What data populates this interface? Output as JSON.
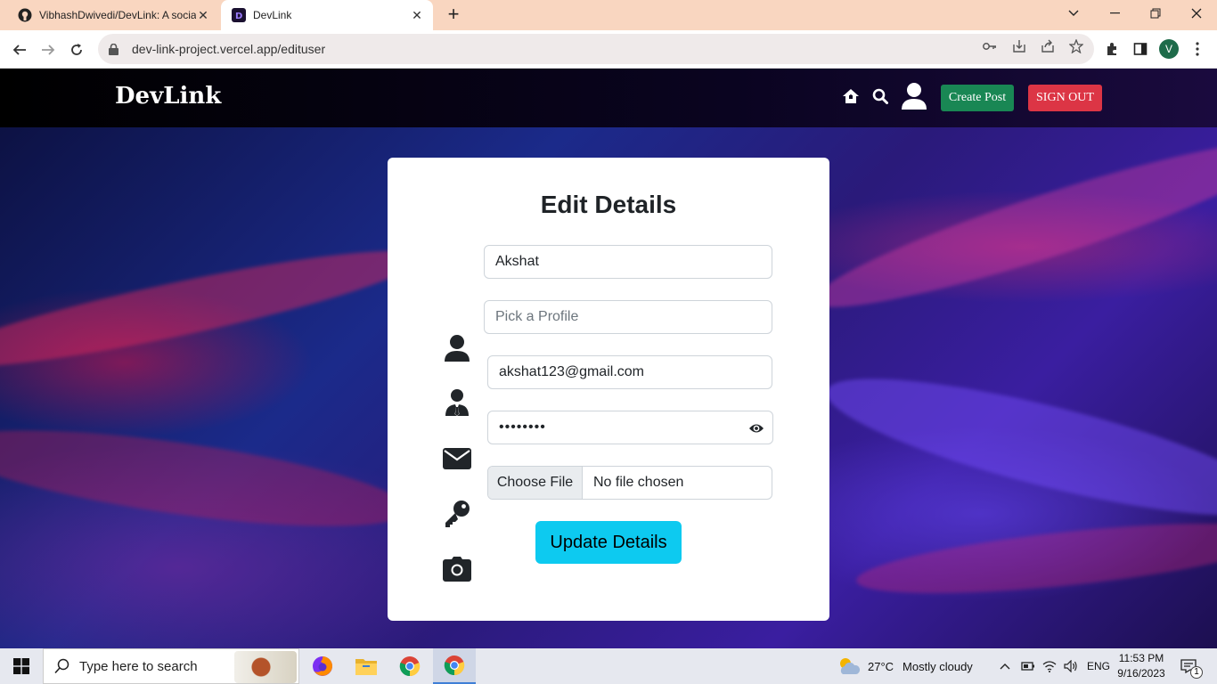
{
  "browser": {
    "tabs": [
      {
        "title": "VibhashDwivedi/DevLink: A socia",
        "favicon": "github-icon",
        "active": false
      },
      {
        "title": "DevLink",
        "favicon": "devlink-icon",
        "active": true
      }
    ],
    "url": "dev-link-project.vercel.app/edituser",
    "profile_initial": "V"
  },
  "app": {
    "brand": "DevLink",
    "create_post": "Create Post",
    "sign_out": "SIGN OUT"
  },
  "form": {
    "title": "Edit Details",
    "name_value": "Akshat",
    "profile_placeholder": "Pick a Profile",
    "email_value": "akshat123@gmail.com",
    "password_masked": "••••••••",
    "file_button": "Choose File",
    "file_status": "No file chosen",
    "submit": "Update Details"
  },
  "taskbar": {
    "search_placeholder": "Type here to search",
    "weather": "27°C",
    "weather_desc": "Mostly cloudy",
    "language": "ENG",
    "time": "11:53 PM",
    "date": "9/16/2023",
    "notification_count": "1"
  },
  "colors": {
    "create_post": "#198754",
    "sign_out": "#dc3545",
    "update_button": "#0dcaf0",
    "tabstrip": "#f9d6c0"
  }
}
